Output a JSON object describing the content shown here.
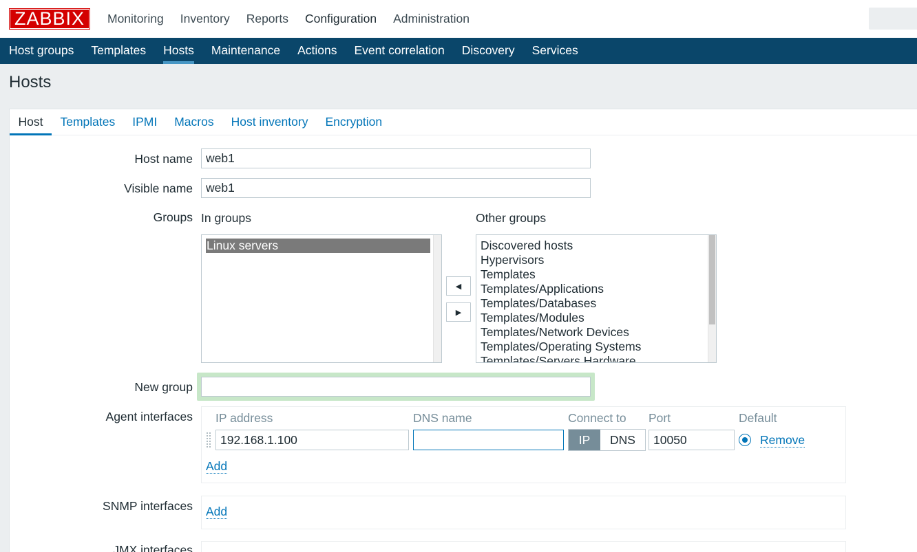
{
  "brand": {
    "logo_text": "ZABBIX",
    "color": "#d40000"
  },
  "top_menu": [
    "Monitoring",
    "Inventory",
    "Reports",
    "Configuration",
    "Administration"
  ],
  "top_menu_active": "Configuration",
  "sub_menu": [
    "Host groups",
    "Templates",
    "Hosts",
    "Maintenance",
    "Actions",
    "Event correlation",
    "Discovery",
    "Services"
  ],
  "sub_menu_active": "Hosts",
  "page_title": "Hosts",
  "tabs": [
    "Host",
    "Templates",
    "IPMI",
    "Macros",
    "Host inventory",
    "Encryption"
  ],
  "tab_active": "Host",
  "form": {
    "host_name_label": "Host name",
    "host_name_value": "web1",
    "visible_name_label": "Visible name",
    "visible_name_value": "web1",
    "groups_label": "Groups",
    "in_groups_label": "In groups",
    "in_groups": [
      "Linux servers"
    ],
    "other_groups_label": "Other groups",
    "other_groups": [
      "Discovered hosts",
      "Hypervisors",
      "Templates",
      "Templates/Applications",
      "Templates/Databases",
      "Templates/Modules",
      "Templates/Network Devices",
      "Templates/Operating Systems",
      "Templates/Servers Hardware"
    ],
    "move_left_icon": "triangle-left-icon",
    "move_right_icon": "triangle-right-icon",
    "new_group_label": "New group",
    "new_group_value": "",
    "agent_interfaces_label": "Agent interfaces",
    "agent_columns": {
      "ip": "IP address",
      "dns": "DNS name",
      "connect": "Connect to",
      "port": "Port",
      "default": "Default"
    },
    "agent_interface": {
      "ip": "192.168.1.100",
      "dns": "",
      "connect_ip": "IP",
      "connect_dns": "DNS",
      "connect_selected": "IP",
      "port": "10050",
      "remove": "Remove"
    },
    "agent_add": "Add",
    "snmp_interfaces_label": "SNMP interfaces",
    "snmp_add": "Add",
    "jmx_interfaces_label": "JMX interfaces"
  },
  "colors": {
    "header_bg": "#0a466a",
    "link": "#0275b8",
    "page_bg": "#ebeef0"
  }
}
